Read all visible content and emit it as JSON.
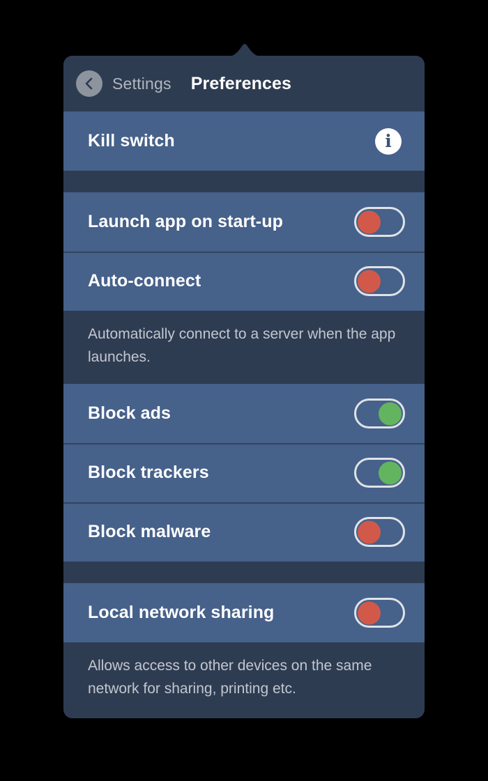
{
  "header": {
    "back_icon": "chevron-left-icon",
    "breadcrumb": "Settings",
    "title": "Preferences"
  },
  "colors": {
    "panel_bg": "#2e3c52",
    "row_bg": "#46618a",
    "toggle_off": "#d2594a",
    "toggle_on": "#63b45f",
    "divider": "#33435b",
    "muted_text": "#c2c7cf",
    "page_bg": "#000000"
  },
  "rows": {
    "kill_switch": {
      "label": "Kill switch",
      "info_icon": "info-icon",
      "info_glyph": "i"
    },
    "launch_startup": {
      "label": "Launch app on start-up",
      "state": "off"
    },
    "auto_connect": {
      "label": "Auto-connect",
      "state": "off",
      "description": "Automatically connect to a server when the app launches."
    },
    "block_ads": {
      "label": "Block ads",
      "state": "on"
    },
    "block_trackers": {
      "label": "Block trackers",
      "state": "on"
    },
    "block_malware": {
      "label": "Block malware",
      "state": "off"
    },
    "local_network_sharing": {
      "label": "Local network sharing",
      "state": "off",
      "description": "Allows access to other devices on the same network for sharing, printing etc."
    }
  }
}
